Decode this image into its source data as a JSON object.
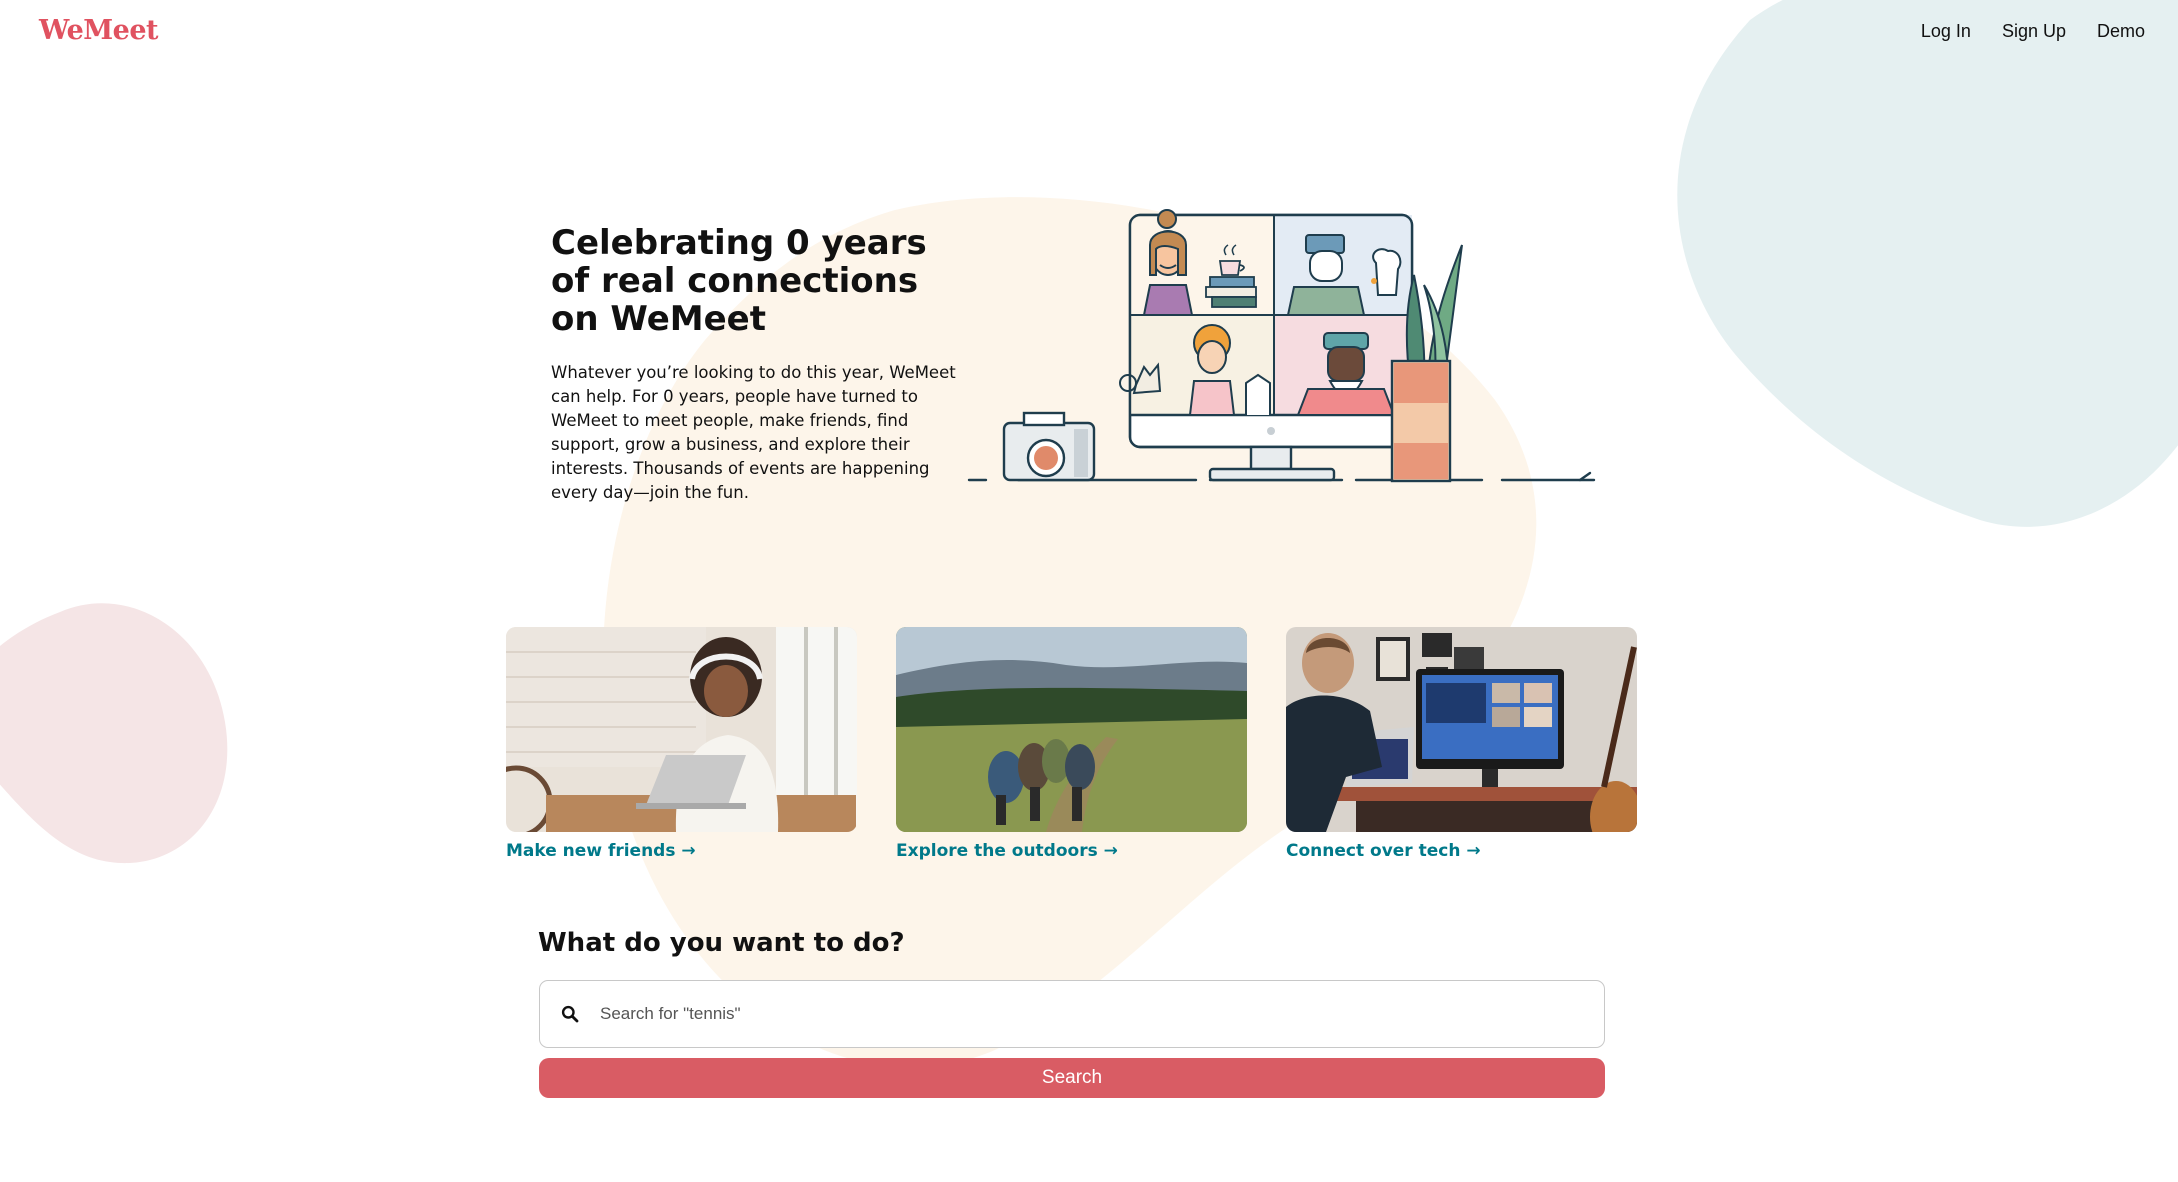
{
  "brand": {
    "logo_text": "WeMeet",
    "accent_color": "#e05260",
    "link_color": "#00798a",
    "button_color": "#d95c64"
  },
  "nav": {
    "login_label": "Log In",
    "signup_label": "Sign Up",
    "demo_label": "Demo"
  },
  "hero": {
    "title": "Celebrating 0 years of real connections on WeMeet",
    "description": "Whatever you’re looking to do this year, WeMeet can help. For 0 years, people have turned to WeMeet to meet people, make friends, find support, grow a business, and explore their interests. Thousands of events are happening every day—join the fun.",
    "illustration": "video-call-illustration"
  },
  "cards": [
    {
      "label": "Make new friends →",
      "image": "woman-on-video-call-photo"
    },
    {
      "label": "Explore the outdoors →",
      "image": "hikers-in-meadow-photo"
    },
    {
      "label": "Connect over tech →",
      "image": "man-at-computer-photo"
    }
  ],
  "search": {
    "heading": "What do you want to do?",
    "placeholder": "Search for \"tennis\"",
    "value": "",
    "icon": "search-icon",
    "button_label": "Search"
  }
}
